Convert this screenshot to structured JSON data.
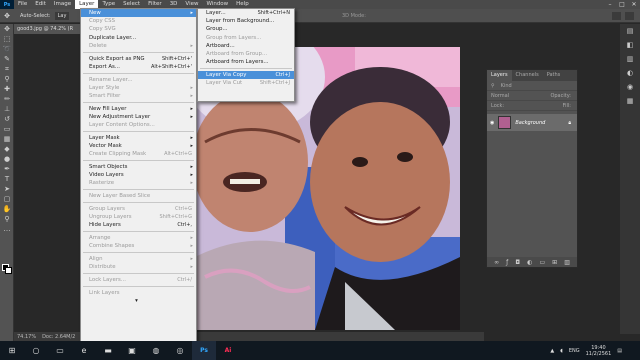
{
  "menubar": {
    "logo": "Ps",
    "items": [
      "File",
      "Edit",
      "Image",
      "Layer",
      "Type",
      "Select",
      "Filter",
      "3D",
      "View",
      "Window",
      "Help"
    ],
    "window_buttons": [
      "–",
      "□",
      "✕"
    ]
  },
  "options_bar": {
    "auto_select_label": "Auto-Select:",
    "auto_select_value": "Lay",
    "mode_3d": "3D Mode:"
  },
  "document": {
    "tab_title": "good3.jpg @ 74.2% (R",
    "zoom": "74.17%",
    "doc_info": "Doc: 2.64M/2"
  },
  "layer_menu": {
    "items": [
      {
        "label": "New",
        "shortcut": "",
        "submenu": true,
        "disabled": false,
        "highlight": true
      },
      {
        "label": "Copy CSS",
        "shortcut": "",
        "disabled": true
      },
      {
        "label": "Copy SVG",
        "shortcut": "",
        "disabled": true
      },
      {
        "label": "Duplicate Layer...",
        "shortcut": "",
        "disabled": false
      },
      {
        "label": "Delete",
        "shortcut": "",
        "submenu": true,
        "disabled": true
      },
      {
        "sep": true
      },
      {
        "label": "Quick Export as PNG",
        "shortcut": "Shift+Ctrl+'",
        "disabled": false
      },
      {
        "label": "Export As...",
        "shortcut": "Alt+Shift+Ctrl+'",
        "disabled": false
      },
      {
        "sep": true
      },
      {
        "label": "Rename Layer...",
        "shortcut": "",
        "disabled": true
      },
      {
        "label": "Layer Style",
        "shortcut": "",
        "submenu": true,
        "disabled": true
      },
      {
        "label": "Smart Filter",
        "shortcut": "",
        "submenu": true,
        "disabled": true
      },
      {
        "sep": true
      },
      {
        "label": "New Fill Layer",
        "shortcut": "",
        "submenu": true,
        "disabled": false
      },
      {
        "label": "New Adjustment Layer",
        "shortcut": "",
        "submenu": true,
        "disabled": false
      },
      {
        "label": "Layer Content Options...",
        "shortcut": "",
        "disabled": true
      },
      {
        "sep": true
      },
      {
        "label": "Layer Mask",
        "shortcut": "",
        "submenu": true,
        "disabled": false
      },
      {
        "label": "Vector Mask",
        "shortcut": "",
        "submenu": true,
        "disabled": false
      },
      {
        "label": "Create Clipping Mask",
        "shortcut": "Alt+Ctrl+G",
        "disabled": true
      },
      {
        "sep": true
      },
      {
        "label": "Smart Objects",
        "shortcut": "",
        "submenu": true,
        "disabled": false
      },
      {
        "label": "Video Layers",
        "shortcut": "",
        "submenu": true,
        "disabled": false
      },
      {
        "label": "Rasterize",
        "shortcut": "",
        "submenu": true,
        "disabled": true
      },
      {
        "sep": true
      },
      {
        "label": "New Layer Based Slice",
        "shortcut": "",
        "disabled": true
      },
      {
        "sep": true
      },
      {
        "label": "Group Layers",
        "shortcut": "Ctrl+G",
        "disabled": true
      },
      {
        "label": "Ungroup Layers",
        "shortcut": "Shift+Ctrl+G",
        "disabled": true
      },
      {
        "label": "Hide Layers",
        "shortcut": "Ctrl+,",
        "disabled": false
      },
      {
        "sep": true
      },
      {
        "label": "Arrange",
        "shortcut": "",
        "submenu": true,
        "disabled": true
      },
      {
        "label": "Combine Shapes",
        "shortcut": "",
        "submenu": true,
        "disabled": true
      },
      {
        "sep": true
      },
      {
        "label": "Align",
        "shortcut": "",
        "submenu": true,
        "disabled": true
      },
      {
        "label": "Distribute",
        "shortcut": "",
        "submenu": true,
        "disabled": true
      },
      {
        "sep": true
      },
      {
        "label": "Lock Layers...",
        "shortcut": "Ctrl+/",
        "disabled": true
      },
      {
        "sep": true
      },
      {
        "label": "Link Layers",
        "shortcut": "",
        "disabled": true
      }
    ],
    "more_arrow": "▾"
  },
  "new_submenu": {
    "items": [
      {
        "label": "Layer...",
        "shortcut": "Shift+Ctrl+N",
        "disabled": false
      },
      {
        "label": "Layer from Background...",
        "shortcut": "",
        "disabled": false
      },
      {
        "label": "Group...",
        "shortcut": "",
        "disabled": false
      },
      {
        "label": "Group from Layers...",
        "shortcut": "",
        "disabled": true
      },
      {
        "label": "Artboard...",
        "shortcut": "",
        "disabled": false
      },
      {
        "label": "Artboard from Group...",
        "shortcut": "",
        "disabled": true
      },
      {
        "label": "Artboard from Layers...",
        "shortcut": "",
        "disabled": false
      },
      {
        "sep": true
      },
      {
        "label": "Layer Via Copy",
        "shortcut": "Ctrl+J",
        "disabled": false,
        "highlight": true
      },
      {
        "label": "Layer Via Cut",
        "shortcut": "Shift+Ctrl+J",
        "disabled": true
      }
    ]
  },
  "layers_panel": {
    "tabs": [
      "Layers",
      "Channels",
      "Paths"
    ],
    "kind_label": "Kind",
    "blend_mode": "Normal",
    "opacity_label": "Opacity:",
    "lock_label": "Lock:",
    "fill_label": "Fill:",
    "layer_name": "Background"
  },
  "taskbar": {
    "search_icon": "search-icon",
    "language": "ENG",
    "time": "19:40",
    "date": "11/2/2561"
  }
}
